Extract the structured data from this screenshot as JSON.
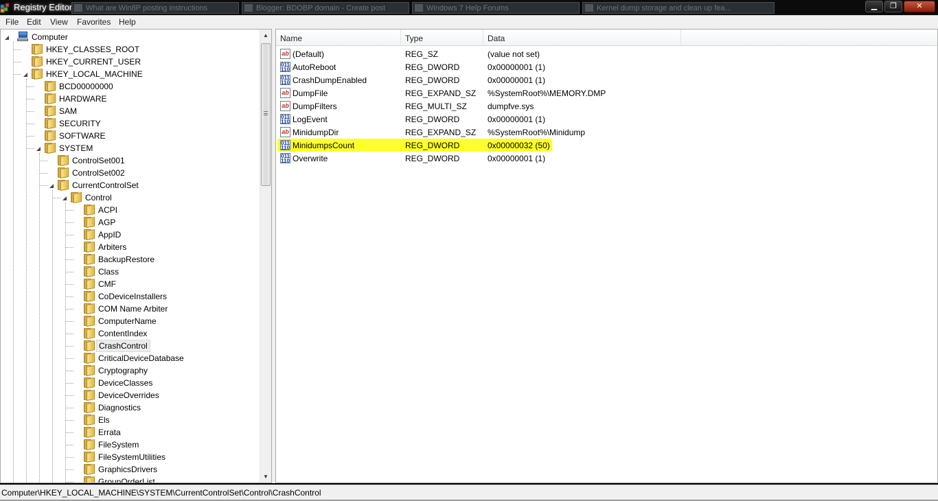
{
  "window": {
    "title": "Registry Editor",
    "background_tasks": [
      "What are Win8P posting instructions",
      "Blogger: BDOBP domain - Create post",
      "Windows 7 Help Forums",
      "Kernel dump storage and clean up fea..."
    ],
    "controls": {
      "minimize": "▁",
      "maximize": "❐",
      "close": "✕"
    }
  },
  "menu": [
    "File",
    "Edit",
    "View",
    "Favorites",
    "Help"
  ],
  "tree": {
    "items": [
      {
        "label": "Computer",
        "depth": 0,
        "state": "expanded",
        "icon": "computer-icon"
      },
      {
        "label": "HKEY_CLASSES_ROOT",
        "depth": 1,
        "state": "collapsed"
      },
      {
        "label": "HKEY_CURRENT_USER",
        "depth": 1,
        "state": "collapsed"
      },
      {
        "label": "HKEY_LOCAL_MACHINE",
        "depth": 1,
        "state": "expanded"
      },
      {
        "label": "BCD00000000",
        "depth": 2,
        "state": "collapsed"
      },
      {
        "label": "HARDWARE",
        "depth": 2,
        "state": "collapsed"
      },
      {
        "label": "SAM",
        "depth": 2,
        "state": "collapsed"
      },
      {
        "label": "SECURITY",
        "depth": 2,
        "state": "leaf"
      },
      {
        "label": "SOFTWARE",
        "depth": 2,
        "state": "collapsed"
      },
      {
        "label": "SYSTEM",
        "depth": 2,
        "state": "expanded"
      },
      {
        "label": "ControlSet001",
        "depth": 3,
        "state": "collapsed"
      },
      {
        "label": "ControlSet002",
        "depth": 3,
        "state": "collapsed"
      },
      {
        "label": "CurrentControlSet",
        "depth": 3,
        "state": "expanded"
      },
      {
        "label": "Control",
        "depth": 4,
        "state": "expanded"
      },
      {
        "label": "ACPI",
        "depth": 5,
        "state": "leaf"
      },
      {
        "label": "AGP",
        "depth": 5,
        "state": "leaf"
      },
      {
        "label": "AppID",
        "depth": 5,
        "state": "collapsed"
      },
      {
        "label": "Arbiters",
        "depth": 5,
        "state": "collapsed"
      },
      {
        "label": "BackupRestore",
        "depth": 5,
        "state": "collapsed"
      },
      {
        "label": "Class",
        "depth": 5,
        "state": "collapsed"
      },
      {
        "label": "CMF",
        "depth": 5,
        "state": "collapsed"
      },
      {
        "label": "CoDeviceInstallers",
        "depth": 5,
        "state": "leaf"
      },
      {
        "label": "COM Name Arbiter",
        "depth": 5,
        "state": "leaf"
      },
      {
        "label": "ComputerName",
        "depth": 5,
        "state": "collapsed"
      },
      {
        "label": "ContentIndex",
        "depth": 5,
        "state": "collapsed"
      },
      {
        "label": "CrashControl",
        "depth": 5,
        "state": "leaf",
        "selected": true
      },
      {
        "label": "CriticalDeviceDatabase",
        "depth": 5,
        "state": "collapsed"
      },
      {
        "label": "Cryptography",
        "depth": 5,
        "state": "collapsed"
      },
      {
        "label": "DeviceClasses",
        "depth": 5,
        "state": "collapsed"
      },
      {
        "label": "DeviceOverrides",
        "depth": 5,
        "state": "collapsed"
      },
      {
        "label": "Diagnostics",
        "depth": 5,
        "state": "collapsed"
      },
      {
        "label": "Els",
        "depth": 5,
        "state": "collapsed"
      },
      {
        "label": "Errata",
        "depth": 5,
        "state": "collapsed"
      },
      {
        "label": "FileSystem",
        "depth": 5,
        "state": "leaf"
      },
      {
        "label": "FileSystemUtilities",
        "depth": 5,
        "state": "leaf"
      },
      {
        "label": "GraphicsDrivers",
        "depth": 5,
        "state": "collapsed"
      },
      {
        "label": "GroupOrderList",
        "depth": 5,
        "state": "leaf"
      }
    ]
  },
  "values": {
    "columns": [
      "Name",
      "Type",
      "Data"
    ],
    "rows": [
      {
        "name": "(Default)",
        "type": "REG_SZ",
        "data": "(value not set)",
        "kind": "string"
      },
      {
        "name": "AutoReboot",
        "type": "REG_DWORD",
        "data": "0x00000001 (1)",
        "kind": "binary"
      },
      {
        "name": "CrashDumpEnabled",
        "type": "REG_DWORD",
        "data": "0x00000001 (1)",
        "kind": "binary"
      },
      {
        "name": "DumpFile",
        "type": "REG_EXPAND_SZ",
        "data": "%SystemRoot%\\MEMORY.DMP",
        "kind": "string"
      },
      {
        "name": "DumpFilters",
        "type": "REG_MULTI_SZ",
        "data": "dumpfve.sys",
        "kind": "string"
      },
      {
        "name": "LogEvent",
        "type": "REG_DWORD",
        "data": "0x00000001 (1)",
        "kind": "binary"
      },
      {
        "name": "MinidumpDir",
        "type": "REG_EXPAND_SZ",
        "data": "%SystemRoot%\\Minidump",
        "kind": "string"
      },
      {
        "name": "MinidumpsCount",
        "type": "REG_DWORD",
        "data": "0x00000032 (50)",
        "kind": "binary",
        "highlighted": true
      },
      {
        "name": "Overwrite",
        "type": "REG_DWORD",
        "data": "0x00000001 (1)",
        "kind": "binary"
      }
    ],
    "highlight_color": "#ffff2a"
  },
  "status_bar": {
    "path": "Computer\\HKEY_LOCAL_MACHINE\\SYSTEM\\CurrentControlSet\\Control\\CrashControl"
  }
}
